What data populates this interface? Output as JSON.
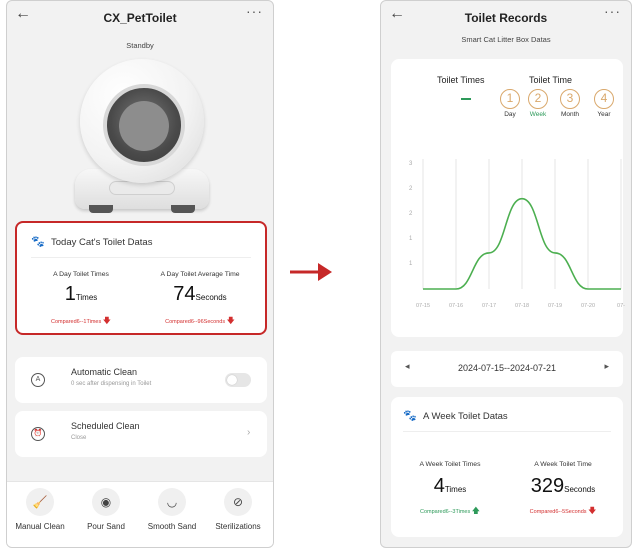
{
  "left": {
    "header": {
      "back": "←",
      "title": "CX_PetToilet",
      "more": "···"
    },
    "status": "Standby",
    "today_card": {
      "title": "Today Cat's Toilet Datas",
      "day_times": {
        "label": "A Day Toilet Times",
        "value": "1",
        "unit": "Times",
        "compare": "Compared6--1Times",
        "trend": "down"
      },
      "day_avg": {
        "label": "A Day Toilet Average Time",
        "value": "74",
        "unit": "Seconds",
        "compare": "Compared6--96Seconds",
        "trend": "down"
      }
    },
    "automatic_clean": {
      "title": "Automatic Clean",
      "subtitle": "0 sec after dispensing in Toilet",
      "enabled": false
    },
    "scheduled_clean": {
      "title": "Scheduled Clean",
      "subtitle": "Close"
    },
    "bottom_actions": [
      {
        "label": "Manual Clean",
        "icon": "broom-icon"
      },
      {
        "label": "Pour Sand",
        "icon": "pour-sand-icon"
      },
      {
        "label": "Smooth Sand",
        "icon": "smooth-sand-icon"
      },
      {
        "label": "Sterilizations",
        "icon": "sterilization-icon"
      }
    ]
  },
  "right": {
    "header": {
      "back": "←",
      "title": "Toilet Records",
      "more": "···"
    },
    "subtitle": "Smart Cat Litter Box Datas",
    "tabs": {
      "times": "Toilet Times",
      "time": "Toilet Time"
    },
    "ranges": [
      {
        "num": "1",
        "label": "Day"
      },
      {
        "num": "2",
        "label": "Week",
        "active": true
      },
      {
        "num": "3",
        "label": "Month"
      },
      {
        "num": "4",
        "label": "Year"
      }
    ],
    "date_range": "2024-07-15--2024-07-21",
    "date_prev": "◂",
    "date_next": "▸",
    "week_card": {
      "title": "A Week Toilet Datas",
      "week_times": {
        "label": "A Week Toilet Times",
        "value": "4",
        "unit": "Times",
        "compare": "Compared6--3Times",
        "trend": "up"
      },
      "week_time": {
        "label": "A Week Toilet Time",
        "value": "329",
        "unit": "Seconds",
        "compare": "Compared6--5Seconds",
        "trend": "down"
      }
    }
  },
  "chart_data": {
    "type": "line",
    "x": [
      "07-15",
      "07-16",
      "07-17",
      "07-18",
      "07-19",
      "07-20",
      "07-21"
    ],
    "series": [
      {
        "values": [
          0,
          0,
          1,
          2.5,
          1,
          0,
          0
        ]
      }
    ],
    "y_ticks": [
      "1",
      "1",
      "2",
      "2",
      "3"
    ],
    "x_tick_labels": [
      "07-15",
      "07-16",
      "07-17",
      "07-18",
      "07-19",
      "07-20",
      "07-"
    ],
    "ylim": [
      0,
      3.6
    ],
    "grid": true,
    "color": "#4caf50"
  },
  "colors": {
    "accent_green": "#2e9a5a",
    "alert_red": "#c62828",
    "range_gold": "#d9a86c"
  }
}
